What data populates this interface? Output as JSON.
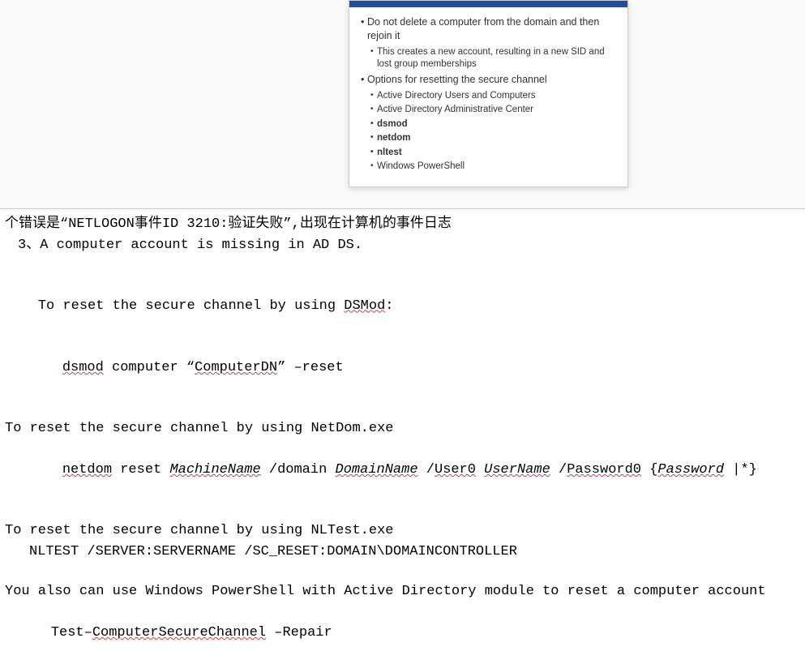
{
  "slide": {
    "bullets": [
      {
        "level": 1,
        "text": "Do not delete a computer from the domain and then rejoin it"
      },
      {
        "level": 2,
        "text": "This creates a new account, resulting in a new SID and lost group memberships"
      },
      {
        "level": 1,
        "text": "Options for resetting the secure channel"
      },
      {
        "level": 2,
        "text": "Active Directory Users and Computers"
      },
      {
        "level": 2,
        "text": "Active Directory Administrative Center"
      },
      {
        "level": 2,
        "text": "dsmod",
        "bold": true
      },
      {
        "level": 2,
        "text": "netdom",
        "bold": true
      },
      {
        "level": 2,
        "text": "nltest",
        "bold": true
      },
      {
        "level": 2,
        "text": "Windows PowerShell"
      }
    ]
  },
  "doc": {
    "line_cutoff": "个错误是“NETLOGON事件ID 3210:验证失败”,出现在计算机的事件日志",
    "line_3": "3、A computer account is missing in AD DS.",
    "sec1_title_pre": "To reset the secure channel by using ",
    "sec1_title_word": "DSMod",
    "sec1_title_post": ":",
    "sec1_cmd_w1": "dsmod",
    "sec1_cmd_mid": " computer “",
    "sec1_cmd_w2": "ComputerDN",
    "sec1_cmd_end": "” –reset",
    "sec2_title": "To reset the secure channel by using NetDom.exe",
    "sec2_w1": "netdom",
    "sec2_t1": " reset ",
    "sec2_w2": "MachineName",
    "sec2_t2": " /domain ",
    "sec2_w3": "DomainName",
    "sec2_t3": " /",
    "sec2_w4": "User0",
    "sec2_t4": " ",
    "sec2_w5": "UserName",
    "sec2_t5": " /",
    "sec2_w6": "Password0",
    "sec2_t6": " {",
    "sec2_w7": "Password",
    "sec2_t7": " |*}",
    "sec3_title": "To reset the secure channel by using NLTest.exe",
    "sec3_cmd": "NLTEST /SERVER:SERVERNAME /SC_RESET:DOMAIN\\DOMAINCONTROLLER",
    "sec4_title": "You also can use Windows PowerShell with Active Directory module to reset a computer account",
    "sec4_t1": "Test–",
    "sec4_w1": "ComputerSecureChannel",
    "sec4_t2": " –Repair"
  }
}
